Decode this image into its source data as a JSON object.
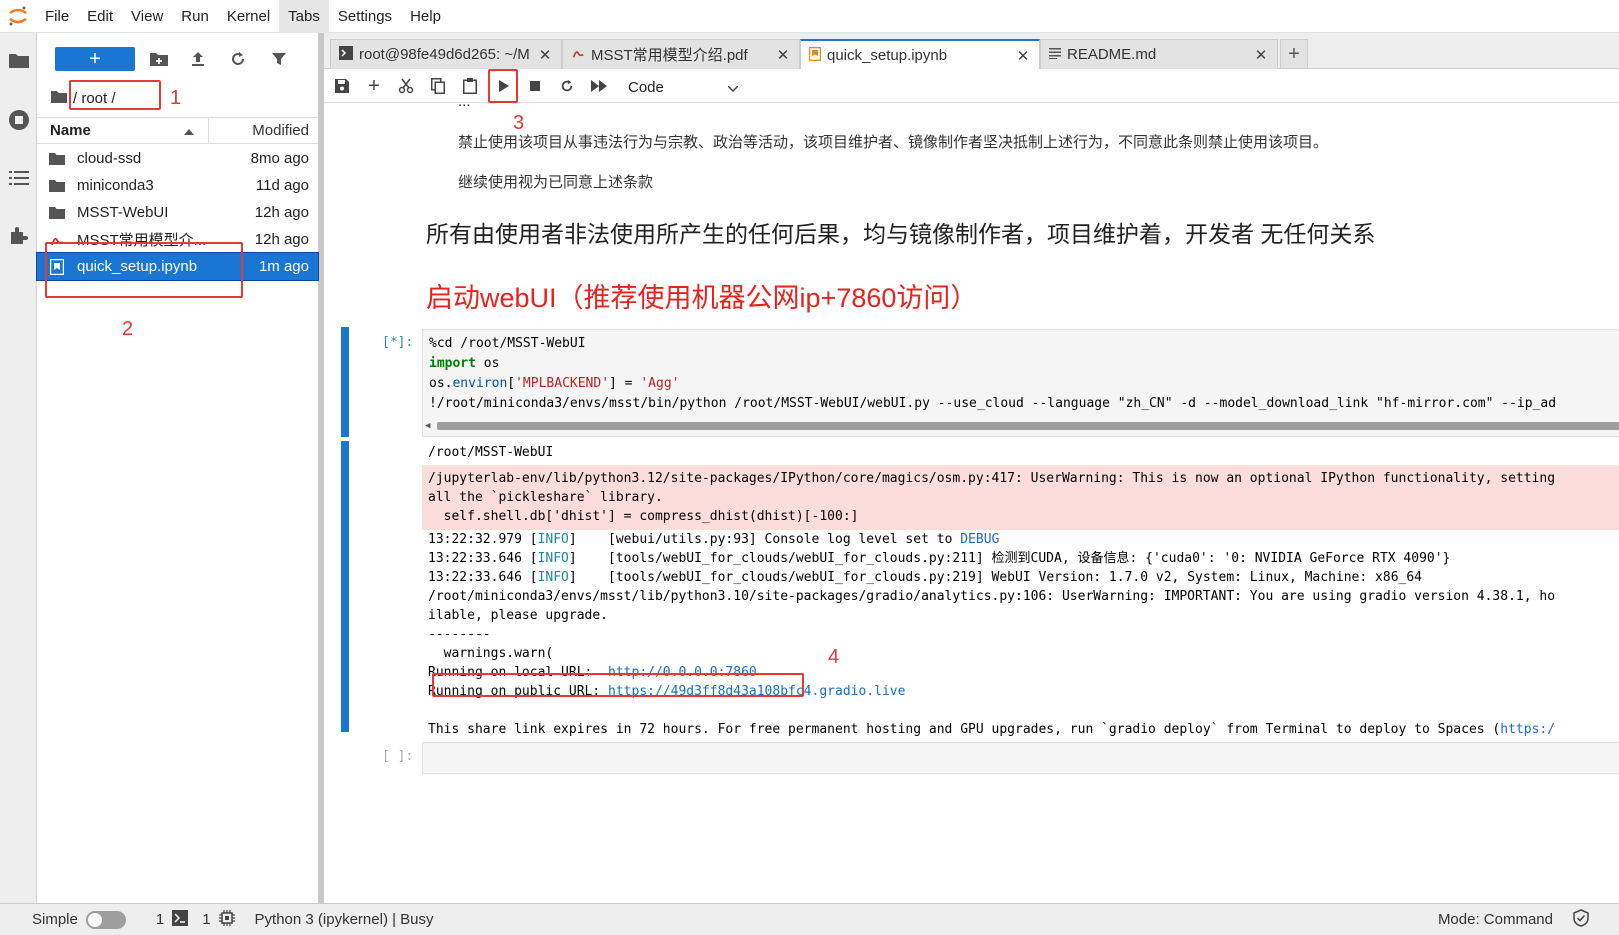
{
  "menubar": {
    "items": [
      "File",
      "Edit",
      "View",
      "Run",
      "Kernel",
      "Tabs",
      "Settings",
      "Help"
    ]
  },
  "filebrowser": {
    "new_label": "+",
    "breadcrumb": "/ root /",
    "columns": {
      "name": "Name",
      "modified": "Modified"
    },
    "files": [
      {
        "name": "cloud-ssd",
        "modified": "8mo ago",
        "icon": "folder-icon"
      },
      {
        "name": "miniconda3",
        "modified": "11d ago",
        "icon": "folder-icon"
      },
      {
        "name": "MSST-WebUI",
        "modified": "12h ago",
        "icon": "folder-icon"
      },
      {
        "name": "MSST常用模型介...",
        "modified": "12h ago",
        "icon": "pdf-icon"
      },
      {
        "name": "quick_setup.ipynb",
        "modified": "1m ago",
        "icon": "notebook-icon"
      }
    ]
  },
  "annotations": [
    "1",
    "2",
    "3",
    "4"
  ],
  "tabs": [
    {
      "label": "root@98fe49d6d265: ~/M",
      "icon": "terminal-icon"
    },
    {
      "label": "MSST常用模型介绍.pdf",
      "icon": "pdf-icon"
    },
    {
      "label": "quick_setup.ipynb",
      "icon": "notebook-icon"
    },
    {
      "label": "README.md",
      "icon": "markdown-icon"
    }
  ],
  "toolbar": {
    "cell_type": "Code"
  },
  "notebook": {
    "md_partial": "...",
    "md_line1": "禁止使用该项目从事违法行为与宗教、政治等活动，该项目维护者、镜像制作者坚决抵制上述行为，不同意此条则禁止使用该项目。",
    "md_line2": "继续使用视为已同意上述条款",
    "md_heading1": "所有由使用者非法使用所产生的任何后果，均与镜像制作者，项目维护着，开发者 无任何关系",
    "md_heading2": "启动webUI（推荐使用机器公网ip+7860访问）",
    "cell1_prompt": "[*]:",
    "cell2_prompt": "[ ]:",
    "code": {
      "l1": "%cd /root/MSST-WebUI",
      "l2_kw": "import",
      "l2_rest": " os",
      "l3_a": "os.",
      "l3_b": "environ",
      "l3_c": "[",
      "l3_d": "'MPLBACKEND'",
      "l3_e": "] = ",
      "l3_f": "'Agg'",
      "l4": "!/root/miniconda3/envs/msst/bin/python /root/MSST-WebUI/webUI.py --use_cloud --language \"zh_CN\" -d --model_download_link \"hf-mirror.com\" --ip_ad"
    },
    "output": {
      "o1": "/root/MSST-WebUI",
      "e1": "/jupyterlab-env/lib/python3.12/site-packages/IPython/core/magics/osm.py:417: UserWarning: This is now an optional IPython functionality, setting",
      "e2": "all the `pickleshare` library.",
      "e3": "  self.shell.db['dhist'] = compress_dhist(dhist)[-100:]",
      "i1_time": "13:22:32.979 [",
      "i1_level": "INFO",
      "i1_mid": "]    [webui/utils.py:93] Console log level set to ",
      "i1_debug": "DEBUG",
      "i2_time": "13:22:33.646 [",
      "i2_level": "INFO",
      "i2_rest": "]    [tools/webUI_for_clouds/webUI_for_clouds.py:211] 检测到CUDA, 设备信息: {'cuda0': '0: NVIDIA GeForce RTX 4090'}",
      "i3_time": "13:22:33.646 [",
      "i3_level": "INFO",
      "i3_rest": "]    [tools/webUI_for_clouds/webUI_for_clouds.py:219] WebUI Version: 1.7.0 v2, System: Linux, Machine: x86_64",
      "w1": "/root/miniconda3/envs/msst/lib/python3.10/site-packages/gradio/analytics.py:106: UserWarning: IMPORTANT: You are using gradio version 4.38.1, ho",
      "w2": "ilable, please upgrade.",
      "w3": "--------",
      "w4": "  warnings.warn(",
      "local_label": "Running on local URL:  ",
      "local_url": "http://0.0.0.0:7860",
      "public_label": "Running on public URL: ",
      "public_url": "https://49d3ff8d43a108bfc4.gradio.live",
      "share_text": "This share link expires in 72 hours. For free permanent hosting and GPU upgrades, run `gradio deploy` from Terminal to deploy to Spaces (",
      "share_link": "https:/"
    }
  },
  "statusbar": {
    "simple": "Simple",
    "terminals": "1",
    "kernels": "1",
    "kernel": "Python 3 (ipykernel) | Busy",
    "mode": "Mode: Command"
  },
  "colors": {
    "accent": "#1976d2",
    "annotation": "#e53935",
    "error_bg": "#fddcdc"
  }
}
